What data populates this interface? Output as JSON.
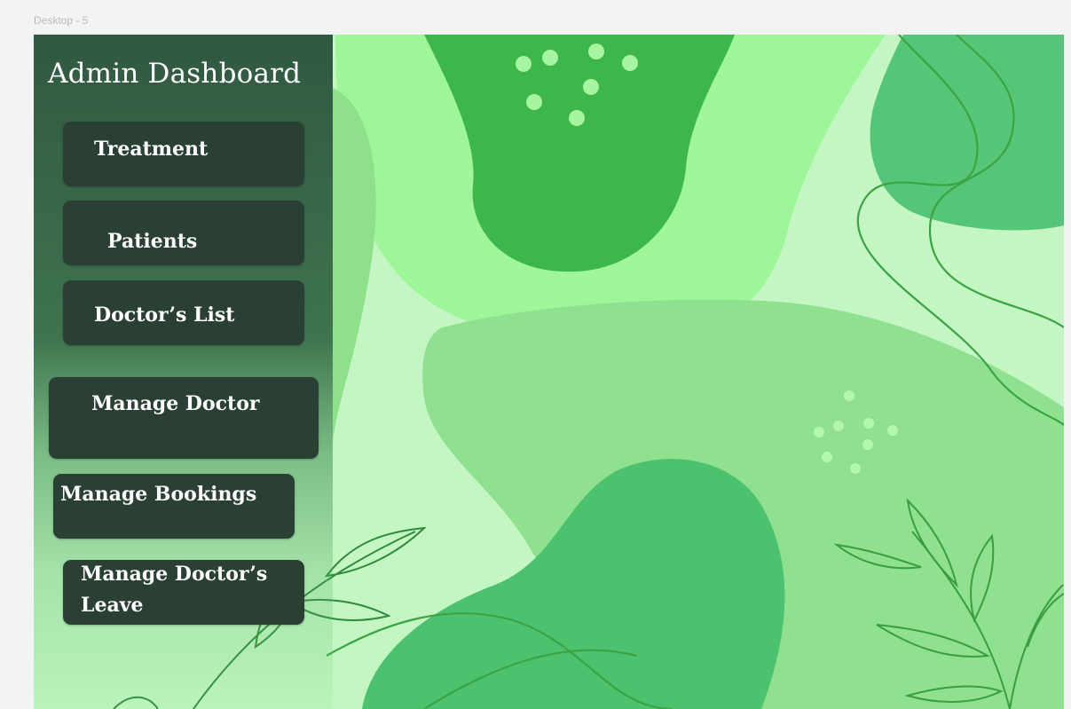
{
  "frame": {
    "label": "Desktop - 5"
  },
  "sidebar": {
    "title": "Admin Dashboard",
    "items": [
      {
        "label": "Treatment"
      },
      {
        "label": "Patients"
      },
      {
        "label": "Doctor’s List"
      },
      {
        "label": "Manage Doctor"
      },
      {
        "label": "Manage Bookings"
      },
      {
        "label": "Manage Doctor’s",
        "label_line2": "Leave"
      }
    ]
  },
  "colors": {
    "sidebar_button": "#2b4034",
    "sidebar_bg": "#2c5e3c",
    "background": "#c4f6c4",
    "accent_dark_green": "#3ab04a",
    "accent_mid_green": "#52c272",
    "accent_light_green": "#9bf29b"
  }
}
